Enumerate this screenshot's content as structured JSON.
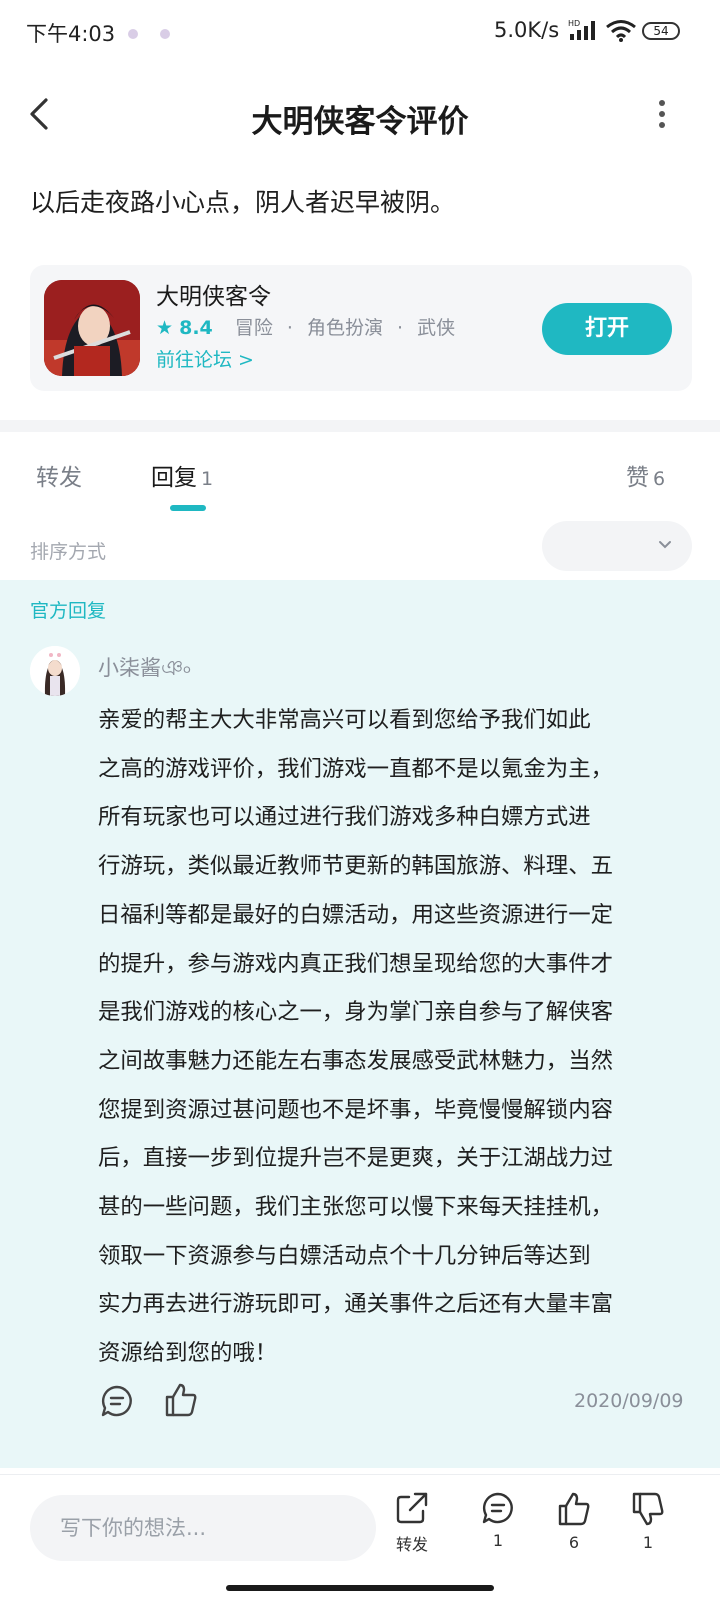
{
  "status_bar": {
    "time": "下午4:03",
    "network_speed": "5.0K/s",
    "battery": "54"
  },
  "header": {
    "title": "大明侠客令评价"
  },
  "review": {
    "text": "以后走夜路小心点，阴人者迟早被阴。"
  },
  "game_card": {
    "name": "大明侠客令",
    "rating": "8.4",
    "tags": [
      "冒险",
      "角色扮演",
      "武侠"
    ],
    "forum_link": "前往论坛 >",
    "open_button": "打开"
  },
  "tabs": {
    "repost": "转发",
    "reply": "回复",
    "reply_count": "1",
    "like": "赞",
    "like_count": "6"
  },
  "sort": {
    "label": "排序方式"
  },
  "official_reply": {
    "section_label": "官方回复",
    "author": "小柒酱ঞ৹",
    "lines": [
      "亲爱的帮主大大非常高兴可以看到您给予我们如此",
      "之高的游戏评价，我们游戏一直都不是以氪金为主，",
      "所有玩家也可以通过进行我们游戏多种白嫖方式进",
      "行游玩，类似最近教师节更新的韩国旅游、料理、五",
      "日福利等都是最好的白嫖活动，用这些资源进行一定",
      "的提升，参与游戏内真正我们想呈现给您的大事件才",
      "是我们游戏的核心之一，身为掌门亲自参与了解侠客",
      "之间故事魅力还能左右事态发展感受武林魅力，当然",
      "您提到资源过甚问题也不是坏事，毕竟慢慢解锁内容",
      "后，直接一步到位提升岂不是更爽，关于江湖战力过",
      "甚的一些问题，我们主张您可以慢下来每天挂挂机，",
      "领取一下资源参与白嫖活动点个十几分钟后等达到",
      "实力再去进行游玩即可，通关事件之后还有大量丰富",
      "资源给到您的哦！"
    ],
    "date": "2020/09/09"
  },
  "bottom_bar": {
    "input_placeholder": "写下你的想法...",
    "repost_label": "转发",
    "comment_count": "1",
    "like_count": "6",
    "dislike_count": "1"
  },
  "colors": {
    "accent": "#1fb8c2",
    "official_bg": "#e9f7f8"
  }
}
